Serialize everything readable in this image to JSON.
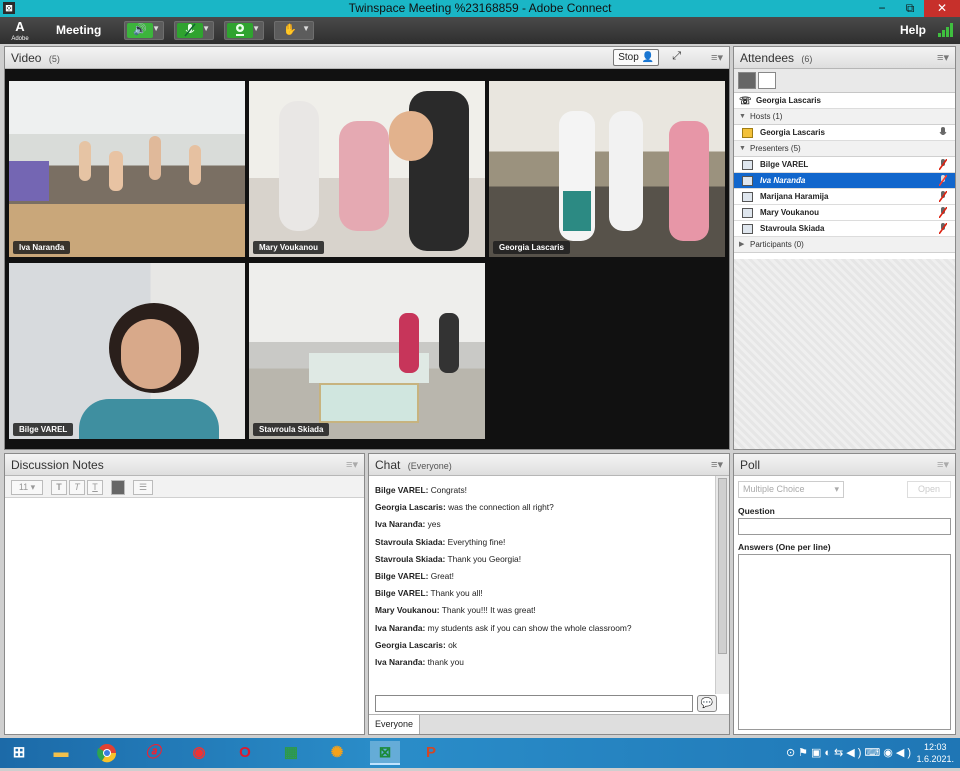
{
  "window": {
    "title": "Twinspace Meeting %23168859 - Adobe Connect",
    "minimize": "−",
    "restore": "⧉",
    "close": "✕"
  },
  "menubar": {
    "logo_text": "Adobe",
    "meeting_label": "Meeting",
    "help_label": "Help"
  },
  "video_pod": {
    "title": "Video",
    "count": "(5)",
    "stop_label": "Stop",
    "tiles": [
      {
        "name": "Iva Naranđa",
        "scene": "classroom-arms-raised"
      },
      {
        "name": "Mary Voukanou",
        "scene": "students-waving-closeup"
      },
      {
        "name": "Georgia Lascaris",
        "scene": "students-waving-computer-lab"
      },
      {
        "name": "Bilge  VAREL",
        "scene": "teacher-portrait"
      },
      {
        "name": "Stavroula Skiada",
        "scene": "classroom-table-wide"
      }
    ]
  },
  "attendees_pod": {
    "title": "Attendees",
    "count": "(6)",
    "me": "Georgia Lascaris",
    "hosts_label": "Hosts (1)",
    "hosts": [
      "Georgia Lascaris"
    ],
    "presenters_label": "Presenters (5)",
    "presenters": [
      "Bilge  VAREL",
      "Iva Naranđa",
      "Marijana Haramija",
      "Mary Voukanou",
      "Stavroula Skiada"
    ],
    "selected_presenter": "Iva Naranđa",
    "participants_label": "Participants (0)"
  },
  "notes_pod": {
    "title": "Discussion Notes",
    "font_size": "11"
  },
  "chat_pod": {
    "title": "Chat",
    "audience": "(Everyone)",
    "messages": [
      {
        "sender": "Bilge  VAREL:",
        "text": "Congrats!"
      },
      {
        "sender": "Georgia Lascaris:",
        "text": "was the connection all right?"
      },
      {
        "sender": "Iva Naranđa:",
        "text": "yes"
      },
      {
        "sender": "Stavroula Skiada:",
        "text": "Everything fine!"
      },
      {
        "sender": "Stavroula Skiada:",
        "text": "Thank you Georgia!"
      },
      {
        "sender": "Bilge  VAREL:",
        "text": "Great!"
      },
      {
        "sender": "Bilge  VAREL:",
        "text": "Thank you all!"
      },
      {
        "sender": "Mary Voukanou:",
        "text": "Thank you!!! It was great!"
      },
      {
        "sender": "Iva Naranđa:",
        "text": "my students ask if you can show the whole classroom?"
      },
      {
        "sender": "Georgia Lascaris:",
        "text": "ok"
      },
      {
        "sender": "Iva Naranđa:",
        "text": "thank you"
      }
    ],
    "input_value": "",
    "tab_label": "Everyone"
  },
  "poll_pod": {
    "title": "Poll",
    "type_value": "Multiple Choice",
    "open_label": "Open",
    "question_label": "Question",
    "answers_label": "Answers (One per line)"
  },
  "taskbar": {
    "clock_time": "12:03",
    "clock_date": "1.6.2021."
  }
}
